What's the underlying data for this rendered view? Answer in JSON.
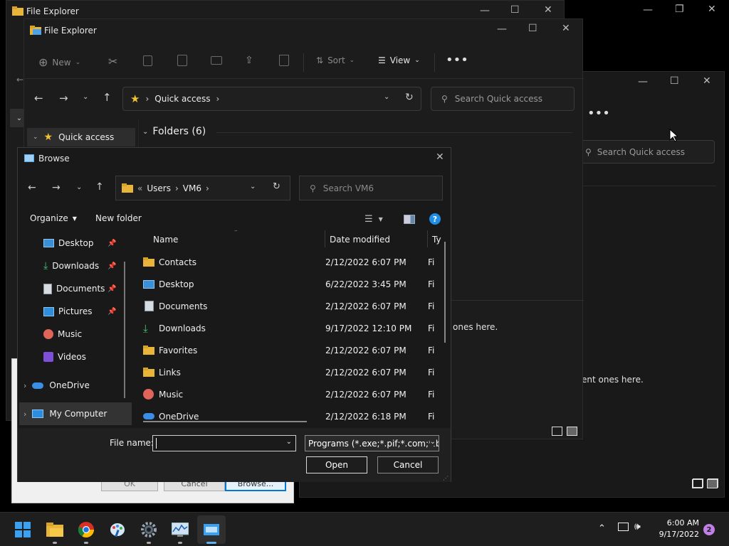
{
  "back_window1": {
    "title": "File Explorer"
  },
  "main_explorer": {
    "title": "File Explorer",
    "toolbar": {
      "new_label": "New",
      "sort_label": "Sort",
      "view_label": "View"
    },
    "breadcrumb": "Quick access",
    "search_placeholder": "Search Quick access",
    "nav_quick_access": "Quick access",
    "folders_header": "Folders (6)",
    "ghost_text1": "ones here."
  },
  "right_window": {
    "search_placeholder": "Search Quick access",
    "ghost_text2": "ent ones here."
  },
  "behind_dialog": {
    "ok": "OK",
    "cancel": "Cancel",
    "browse": "Browse..."
  },
  "browse_dialog": {
    "title": "Browse",
    "path": {
      "prefix": "«",
      "seg1": "Users",
      "seg2": "VM6"
    },
    "search_placeholder": "Search VM6",
    "organize_label": "Organize",
    "new_folder_label": "New folder",
    "nav_items": [
      {
        "label": "Desktop"
      },
      {
        "label": "Downloads"
      },
      {
        "label": "Documents"
      },
      {
        "label": "Pictures"
      },
      {
        "label": "Music"
      },
      {
        "label": "Videos"
      },
      {
        "label": "OneDrive"
      },
      {
        "label": "My Computer"
      }
    ],
    "columns": {
      "name": "Name",
      "date": "Date modified",
      "type": "Ty"
    },
    "files": [
      {
        "name": "Contacts",
        "date": "2/12/2022 6:07 PM",
        "type": "Fi"
      },
      {
        "name": "Desktop",
        "date": "6/22/2022 3:45 PM",
        "type": "Fi"
      },
      {
        "name": "Documents",
        "date": "2/12/2022 6:07 PM",
        "type": "Fi"
      },
      {
        "name": "Downloads",
        "date": "9/17/2022 12:10 PM",
        "type": "Fi"
      },
      {
        "name": "Favorites",
        "date": "2/12/2022 6:07 PM",
        "type": "Fi"
      },
      {
        "name": "Links",
        "date": "2/12/2022 6:07 PM",
        "type": "Fi"
      },
      {
        "name": "Music",
        "date": "2/12/2022 6:07 PM",
        "type": "Fi"
      },
      {
        "name": "OneDrive",
        "date": "2/12/2022 6:18 PM",
        "type": "Fi"
      }
    ],
    "file_name_label": "File name:",
    "file_name_value": "",
    "filter_value": "Programs (*.exe;*.pif;*.com;*.ba",
    "open_label": "Open",
    "cancel_label": "Cancel"
  },
  "taskbar": {
    "time": "6:00 AM",
    "date": "9/17/2022",
    "notification_count": "2"
  }
}
